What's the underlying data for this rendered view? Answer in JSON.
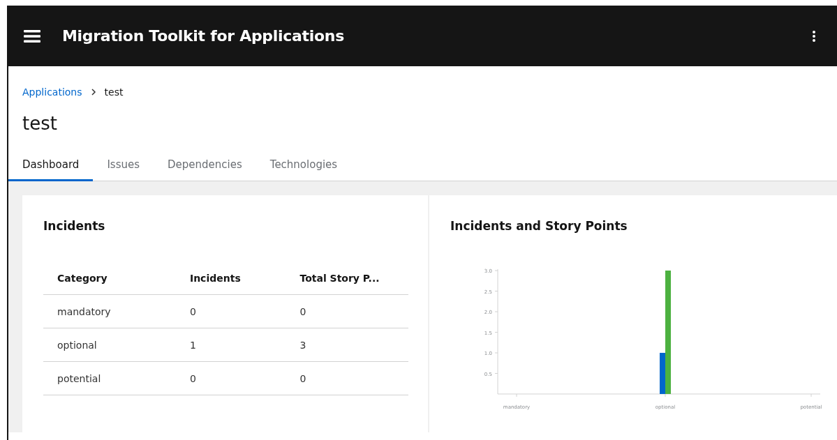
{
  "masthead": {
    "title": "Migration Toolkit for Applications"
  },
  "breadcrumb": [
    "Applications",
    "test"
  ],
  "page_title": "test",
  "tabs": [
    {
      "label": "Dashboard",
      "selected": true
    },
    {
      "label": "Issues",
      "selected": false
    },
    {
      "label": "Dependencies",
      "selected": false
    },
    {
      "label": "Technologies",
      "selected": false
    }
  ],
  "incidents_card": {
    "title": "Incidents",
    "columns": [
      "Category",
      "Incidents",
      "Total Story P..."
    ],
    "rows": [
      [
        "mandatory",
        "0",
        "0"
      ],
      [
        "optional",
        "1",
        "3"
      ],
      [
        "potential",
        "0",
        "0"
      ]
    ]
  },
  "chart_card": {
    "title": "Incidents and Story Points",
    "chart_data": {
      "type": "bar",
      "categories": [
        "mandatory",
        "optional",
        "potential"
      ],
      "series": [
        {
          "color": "#0066cc",
          "values": [
            0,
            1,
            0
          ]
        },
        {
          "color": "#4cb140",
          "values": [
            0,
            3,
            0
          ]
        }
      ],
      "ylim": [
        0,
        3
      ],
      "yticks": [
        {
          "value": 0.5,
          "label": "0.5"
        },
        {
          "value": 1,
          "label": "1.0"
        },
        {
          "value": 1.5,
          "label": "1.5"
        },
        {
          "value": 2,
          "label": "2.0"
        },
        {
          "value": 2.5,
          "label": "2.5"
        },
        {
          "value": 3,
          "label": "3.0"
        }
      ]
    }
  }
}
